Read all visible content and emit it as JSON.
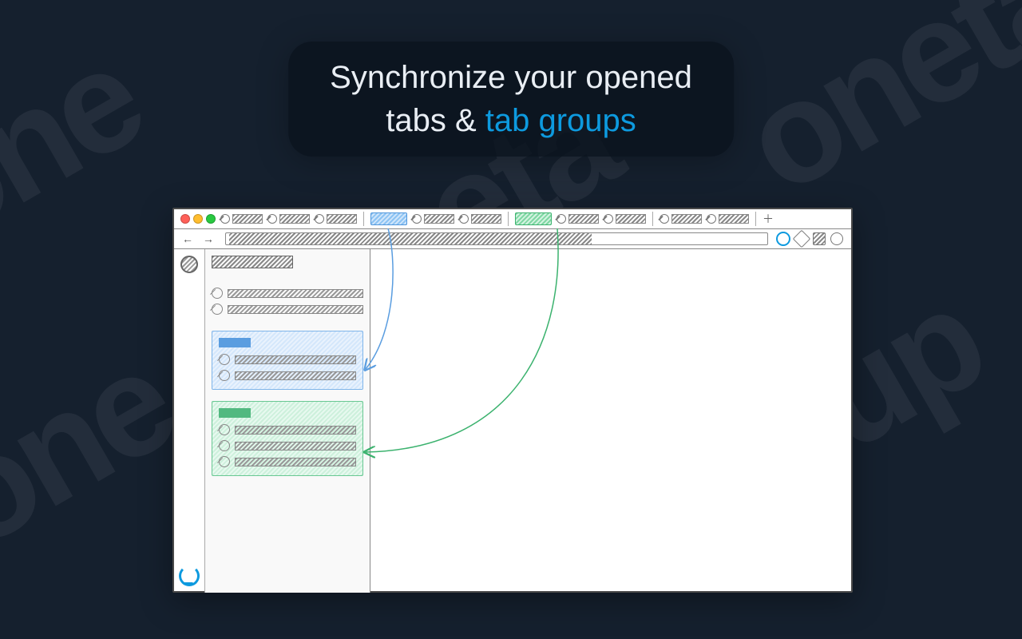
{
  "headline": {
    "line1": "Synchronize your opened",
    "line2a": "tabs & ",
    "line2b": "tab groups"
  },
  "colors": {
    "accent": "#0d9adf",
    "groupBlue": "#5a9de0",
    "groupGreen": "#52b980"
  },
  "browser": {
    "newTabGlyph": "＋",
    "navArrows": "←  →"
  }
}
